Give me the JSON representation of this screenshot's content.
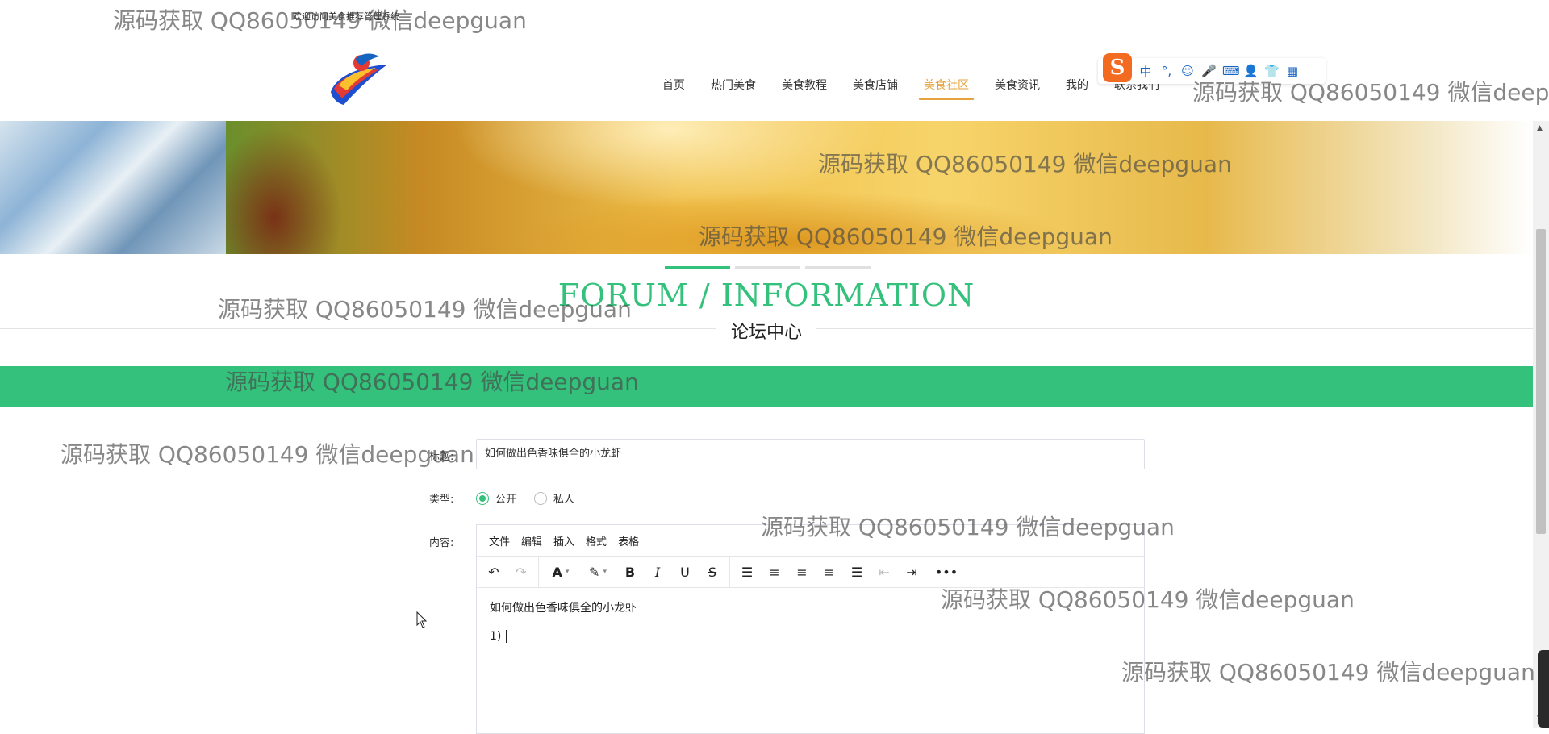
{
  "topbar": {
    "welcome": "欢迎访问美食推荐管理系统"
  },
  "nav": {
    "items": [
      "首页",
      "热门美食",
      "美食教程",
      "美食店铺",
      "美食社区",
      "美食资讯",
      "我的",
      "联系我们"
    ],
    "active_index": 4,
    "active_color": "#e6a23c"
  },
  "ime": {
    "logo": "S",
    "buttons": [
      "中",
      "°,",
      "☺",
      "🎤",
      "⌨",
      "👤",
      "👕",
      "▦"
    ]
  },
  "banner": {
    "indicators": 3,
    "active_indicator": 0
  },
  "section": {
    "title_en": "FORUM / INFORMATION",
    "title_cn": "论坛中心",
    "accent_color": "#34c17b"
  },
  "form": {
    "title_label": "标题:",
    "title_value": "如何做出色香味俱全的小龙虾",
    "type_label": "类型:",
    "type_options": [
      "公开",
      "私人"
    ],
    "type_selected": "公开",
    "content_label": "内容:",
    "editor": {
      "menus": [
        "文件",
        "编辑",
        "插入",
        "格式",
        "表格"
      ],
      "toolbar_icons": [
        "undo-icon",
        "redo-icon",
        "font-color-icon",
        "highlight-icon",
        "bold-icon",
        "italic-icon",
        "underline-icon",
        "strikethrough-icon",
        "numbered-list-icon",
        "align-left-icon",
        "align-center-icon",
        "align-right-icon",
        "align-justify-icon",
        "outdent-icon",
        "indent-icon",
        "more-icon"
      ],
      "line1": "如何做出色香味俱全的小龙虾",
      "line2": "1)"
    }
  },
  "watermark": "源码获取 QQ86050149 微信deepguan"
}
